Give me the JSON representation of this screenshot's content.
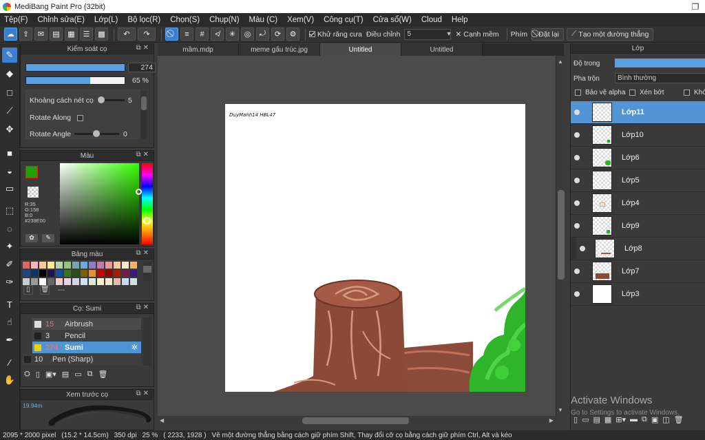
{
  "title_bar": {
    "title": "MediBang Paint Pro (32bit)"
  },
  "menu": [
    "Tệp(F)",
    "Chỉnh sửa(E)",
    "Lớp(L)",
    "Bộ lọc(R)",
    "Chọn(S)",
    "Chụp(N)",
    "Màu (C)",
    "Xem(V)",
    "Công cụ(T)",
    "Cửa sổ(W)",
    "Cloud",
    "Help"
  ],
  "toolbar": {
    "antialias_label": "Khử răng cưa",
    "adjust_label": "Điều chỉnh",
    "adjust_value": "5",
    "edge_label": "Cạnh mềm",
    "key_label": "Phím",
    "reset_label": "Đặt lại",
    "create_line_label": "Tạo một đường thẳng"
  },
  "brush_control": {
    "title": "Kiểm soát cọ",
    "size_value": "274",
    "opacity_value": "65 %",
    "opacity_fraction": 0.65,
    "stroke_spacing_label": "Khoảng cách nét cọ",
    "stroke_spacing_value": "5",
    "rotate_along_label": "Rotate Along",
    "rotate_angle_label": "Rotate Angle",
    "rotate_angle_value": "0"
  },
  "color_panel": {
    "title": "Màu",
    "r": "R:35",
    "g": "G:158",
    "b": "B:0",
    "hex": "#239E00",
    "foreground": "#239E00"
  },
  "palette_panel": {
    "title": "Bảng màu",
    "dash": "---",
    "swatches_row1": [
      "#e06666",
      "#f4b6b6",
      "#f9cb9c",
      "#ffe599",
      "#b6d7a8",
      "#93c47d",
      "#76a5af",
      "#6fa8dc",
      "#8e7cc3",
      "#c27ba0",
      "#ea9999",
      "#f9cb9c",
      "#fce5cd",
      "#f6b26b"
    ],
    "swatches_row2": [
      "#1c4587",
      "#073763",
      "#000000",
      "#20124d",
      "#0b5394",
      "#38761d",
      "#274e13",
      "#7f6000",
      "#e69138",
      "#cc0000",
      "#990000",
      "#a61c00",
      "#741b47",
      "#351c75"
    ],
    "swatches_row3": [
      "#cccccc",
      "#999999",
      "#ffffff",
      "#666666",
      "#f4cccc",
      "#ead1dc",
      "#d9d2e9",
      "#cfe2f3",
      "#d9ead3",
      "#fff2cc",
      "#fce5cd",
      "#e6b8af",
      "#c9daf8",
      "#d0e0e3"
    ]
  },
  "brush_list": {
    "title": "Cọ: Sumi",
    "items": [
      {
        "size": "15",
        "name": "Airbrush"
      },
      {
        "size": "3",
        "name": "Pencil"
      },
      {
        "size": "274",
        "name": "Sumi"
      },
      {
        "size": "10",
        "name": "Pen (Sharp)"
      }
    ]
  },
  "preview_panel": {
    "title": "Xem trước cọ",
    "size_label": "19.94m"
  },
  "tabs": [
    "mầm.mdp",
    "meme gấu trúc.jpg",
    "Untitled",
    "Untitled"
  ],
  "canvas": {
    "signature": "DuyManh14 HBL47"
  },
  "layer_panel": {
    "title": "Lớp",
    "opacity_label": "Độ trong",
    "blend_label": "Pha trộn",
    "blend_value": "Bình thường",
    "protect_alpha": "Bảo vệ alpha",
    "clip": "Xén bớt",
    "lock": "Khóa",
    "layers": [
      "Lớp11",
      "Lớp10",
      "Lớp6",
      "Lớp5",
      "Lớp4",
      "Lớp9",
      "Lớp8",
      "Lớp7",
      "Lớp3"
    ],
    "watermark_line1": "Activate Windows",
    "watermark_line2": "Go to Settings to activate Windows."
  },
  "status": {
    "size": "2095 * 2000 pixel",
    "cm": "(15.2 * 14.5cm)",
    "dpi": "350 dpi",
    "zoom": "25 %",
    "coords": "( 2233, 1928 )",
    "hint": "Vẽ một đường thẳng bằng cách giữ phím Shift, Thay đổi cỡ cọ bằng cách giữ phím Ctrl, Alt và kéo"
  }
}
